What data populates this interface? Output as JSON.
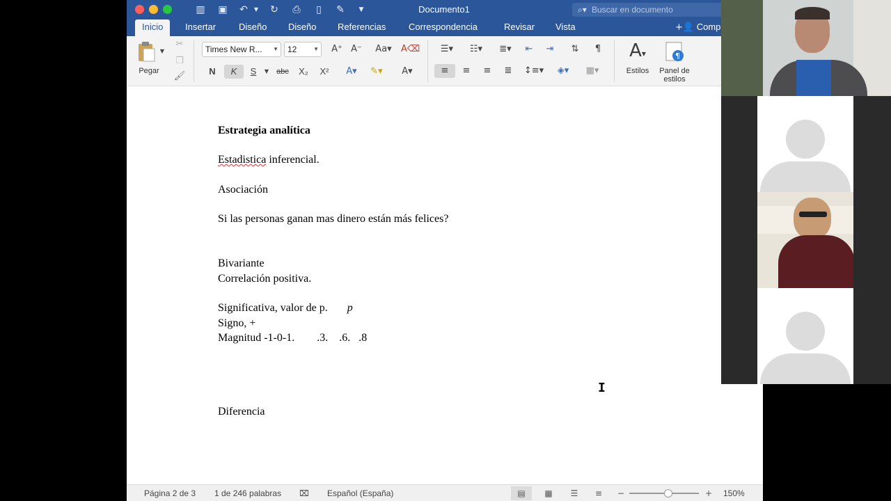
{
  "window": {
    "title": "Documento1",
    "search_placeholder": "Buscar en documento",
    "share_label": "Compa"
  },
  "tabs": [
    "Inicio",
    "Insertar",
    "Diseño",
    "Diseño",
    "Referencias",
    "Correspondencia",
    "Revisar",
    "Vista"
  ],
  "ribbon": {
    "paste_label": "Pegar",
    "font_name": "Times New R...",
    "font_size": "12",
    "bold": "N",
    "italic": "K",
    "underline": "S",
    "strike": "abc",
    "subscript": "X₂",
    "superscript": "X²",
    "styles_label": "Estilos",
    "styles_pane_label_1": "Panel de",
    "styles_pane_label_2": "estilos"
  },
  "document": {
    "heading": "Estrategia analítica",
    "line1_misspelled": "Estadistica",
    "line1_rest": " inferencial.",
    "line2": "Asociación",
    "line3": "Si las personas ganan mas dinero están más felices?",
    "line4": "Bivariante",
    "line5": "Correlación positiva.",
    "line6": "Significativa, valor de p.",
    "line6_italic": "p",
    "line7": "Signo, +",
    "line8": "Magnitud -1-0-1.        .3.    .6.   .8",
    "line9": "Diferencia"
  },
  "status": {
    "page": "Página 2 de 3",
    "words": "1 de 246 palabras",
    "language": "Español (España)",
    "zoom": "150%"
  },
  "colors": {
    "word_blue": "#2b579a",
    "ribbon_bg": "#f3f3f3"
  }
}
